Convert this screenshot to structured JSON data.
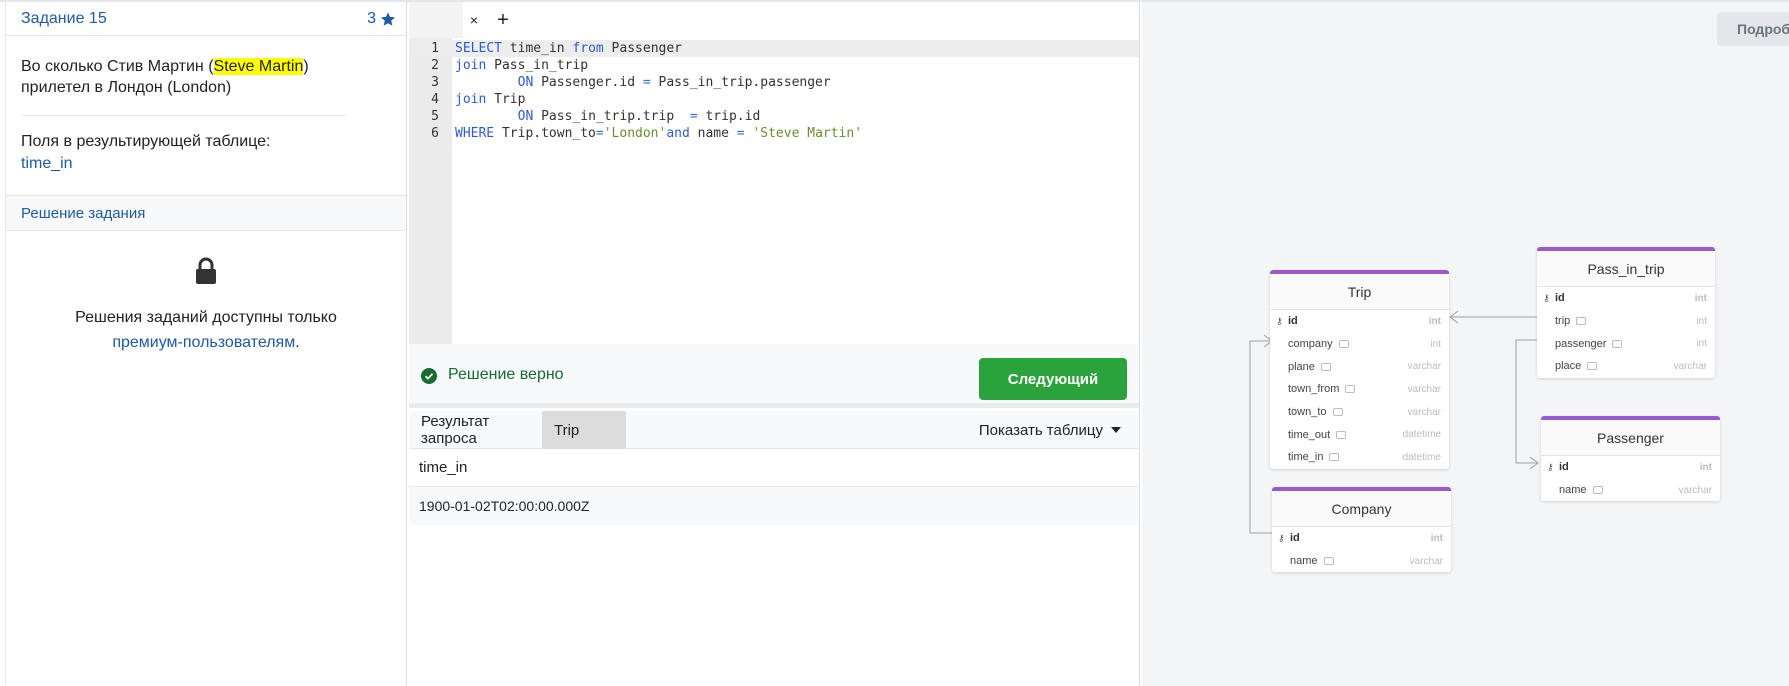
{
  "task": {
    "title": "Задание 15",
    "rating": "3",
    "question_prefix": "Во сколько Стив Мартин (",
    "question_highlight": "Steve Martin",
    "question_suffix": ") прилетел в Лондон (London)",
    "fields_label": "Поля в результирующей таблице:",
    "fields_value": "time_in",
    "solution_label": "Решение задания",
    "locked_text": "Решения заданий доступны только",
    "locked_link": "премиум-пользователям",
    "locked_period": "."
  },
  "editor": {
    "tab_close": "×",
    "tab_add": "+",
    "lines": [
      {
        "n": "1",
        "parts": [
          [
            "kw",
            "SELECT"
          ],
          [
            "t",
            " time_in "
          ],
          [
            "kw",
            "from"
          ],
          [
            "t",
            " Passenger"
          ]
        ]
      },
      {
        "n": "2",
        "parts": [
          [
            "kw",
            "join"
          ],
          [
            "t",
            " Pass_in_trip"
          ]
        ]
      },
      {
        "n": "3",
        "parts": [
          [
            "t",
            "        "
          ],
          [
            "kw",
            "ON"
          ],
          [
            "t",
            " Passenger.id "
          ],
          [
            "op",
            "="
          ],
          [
            "t",
            " Pass_in_trip.passenger"
          ]
        ]
      },
      {
        "n": "4",
        "parts": [
          [
            "kw",
            "join"
          ],
          [
            "t",
            " Trip"
          ]
        ]
      },
      {
        "n": "5",
        "parts": [
          [
            "t",
            "        "
          ],
          [
            "kw",
            "ON"
          ],
          [
            "t",
            " Pass_in_trip.trip  "
          ],
          [
            "op",
            "="
          ],
          [
            "t",
            " trip.id"
          ]
        ]
      },
      {
        "n": "6",
        "parts": [
          [
            "kw",
            "WHERE"
          ],
          [
            "t",
            " Trip.town_to"
          ],
          [
            "op",
            "="
          ],
          [
            "str",
            "'London'"
          ],
          [
            "kw",
            "and"
          ],
          [
            "t",
            " name "
          ],
          [
            "op",
            "="
          ],
          [
            "t",
            " "
          ],
          [
            "str",
            "'Steve Martin'"
          ]
        ]
      }
    ],
    "status_text": "Решение верно",
    "next_label": "Следующий"
  },
  "results": {
    "tab_result": "Результат запроса",
    "tab_trip": "Trip",
    "show_table": "Показать таблицу",
    "column": "time_in",
    "value": "1900-01-02T02:00:00.000Z"
  },
  "schema": {
    "more_label": "Подроб",
    "tables": {
      "trip": {
        "name": "Trip",
        "columns": [
          {
            "name": "id",
            "type": "int",
            "pk": true
          },
          {
            "name": "company",
            "type": "int"
          },
          {
            "name": "plane",
            "type": "varchar"
          },
          {
            "name": "town_from",
            "type": "varchar"
          },
          {
            "name": "town_to",
            "type": "varchar"
          },
          {
            "name": "time_out",
            "type": "datetime"
          },
          {
            "name": "time_in",
            "type": "datetime"
          }
        ]
      },
      "pass_in_trip": {
        "name": "Pass_in_trip",
        "columns": [
          {
            "name": "id",
            "type": "int",
            "pk": true
          },
          {
            "name": "trip",
            "type": "int"
          },
          {
            "name": "passenger",
            "type": "int"
          },
          {
            "name": "place",
            "type": "varchar"
          }
        ]
      },
      "passenger": {
        "name": "Passenger",
        "columns": [
          {
            "name": "id",
            "type": "int",
            "pk": true
          },
          {
            "name": "name",
            "type": "varchar"
          }
        ]
      },
      "company": {
        "name": "Company",
        "columns": [
          {
            "name": "id",
            "type": "int",
            "pk": true
          },
          {
            "name": "name",
            "type": "varchar"
          }
        ]
      }
    },
    "colors": {
      "header_accent": "#9b59d0"
    }
  }
}
